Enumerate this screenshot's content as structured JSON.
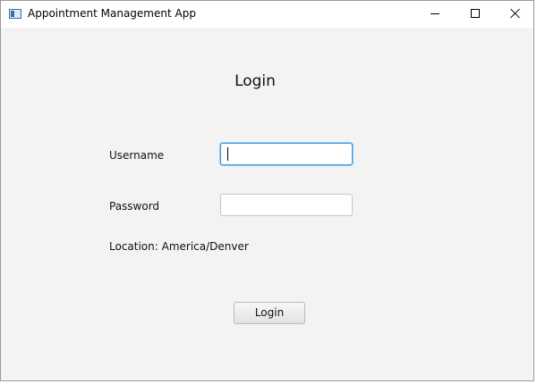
{
  "window": {
    "title": "Appointment Management App",
    "icon": "app-window-icon"
  },
  "titlebar_buttons": {
    "minimize_icon": "minimize-icon",
    "maximize_icon": "maximize-icon",
    "close_icon": "close-icon"
  },
  "form": {
    "heading": "Login",
    "username_label": "Username",
    "username_value": "",
    "password_label": "Password",
    "password_value": "",
    "location_text": "Location: America/Denver",
    "login_button_label": "Login"
  },
  "colors": {
    "focus_border": "#3a9bd9",
    "window_background": "#f3f3f3"
  }
}
